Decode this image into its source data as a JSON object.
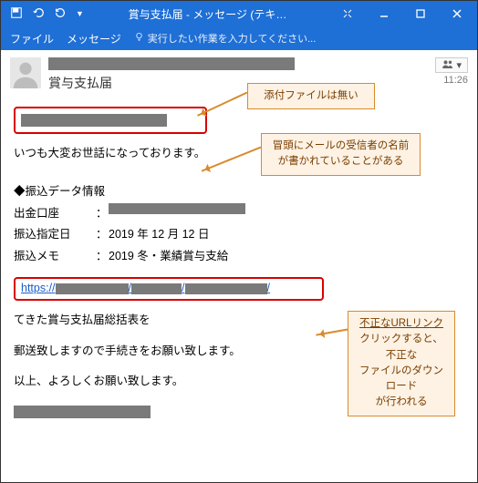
{
  "window": {
    "title": "賞与支払届 - メッセージ (テキ…"
  },
  "ribbon": {
    "tab_file": "ファイル",
    "tab_message": "メッセージ",
    "search_placeholder": "実行したい作業を入力してください..."
  },
  "header": {
    "subject": "賞与支払届",
    "people_label": "▾",
    "time": "11:26"
  },
  "body": {
    "greeting": "いつも大変お世話になっております。",
    "section_title": "◆振込データ情報",
    "rows": {
      "r1_label": "出金口座",
      "r2_label": "振込指定日",
      "r2_value": "2019 年 12 月 12 日",
      "r3_label": "振込メモ",
      "r3_value": "2019 冬・業績賞与支給"
    },
    "link_prefix": "https://",
    "para1": "てきた賞与支払届総括表を",
    "para2": "郵送致しますので手続きをお願い致します。",
    "para3": "以上、よろしくお願い致します。"
  },
  "callouts": {
    "c1": "添付ファイルは無い",
    "c2_l1": "冒頭にメールの受信者の名前",
    "c2_l2": "が書かれていることがある",
    "c3_l1": "不正なURLリンク",
    "c3_l2": "クリックすると、不正な",
    "c3_l3": "ファイルのダウンロード",
    "c3_l4": "が行われる"
  }
}
